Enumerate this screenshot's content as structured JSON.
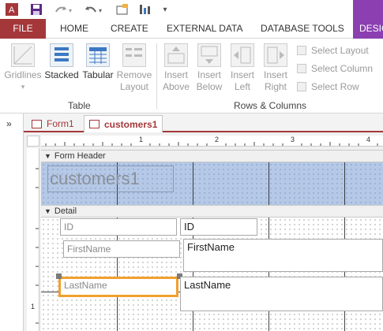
{
  "qat": {
    "icons": [
      "access-logo-icon",
      "save-icon",
      "redo-icon",
      "undo-icon",
      "form-view-icon",
      "design-tool-icon",
      "customize-icon"
    ]
  },
  "tabs": {
    "file": "FILE",
    "home": "HOME",
    "create": "CREATE",
    "external": "EXTERNAL DATA",
    "dbtools": "DATABASE TOOLS",
    "design": "DESIG"
  },
  "ribbon": {
    "table_group": {
      "label": "Table",
      "gridlines": "Gridlines",
      "stacked": "Stacked",
      "tabular": "Tabular",
      "remove_layout_1": "Remove",
      "remove_layout_2": "Layout"
    },
    "rows_columns_group": {
      "label": "Rows & Columns",
      "insert_above_1": "Insert",
      "insert_above_2": "Above",
      "insert_below_1": "Insert",
      "insert_below_2": "Below",
      "insert_left_1": "Insert",
      "insert_left_2": "Left",
      "insert_right_1": "Insert",
      "insert_right_2": "Right",
      "select_layout": "Select Layout",
      "select_column": "Select Column",
      "select_row": "Select Row"
    }
  },
  "nav": {
    "chevron": "»"
  },
  "doc_tabs": [
    {
      "label": "Form1",
      "active": false
    },
    {
      "label": "customers1",
      "active": true
    }
  ],
  "design": {
    "ruler_numbers": [
      "1",
      "2",
      "3",
      "4"
    ],
    "vruler_numbers": [
      "1"
    ],
    "form_header_label": "Form Header",
    "detail_label": "Detail",
    "title": "customers1",
    "fields": [
      {
        "label": "ID",
        "value": "ID"
      },
      {
        "label": "FirstName",
        "value": "FirstName"
      },
      {
        "label": "LastName",
        "value": "LastName"
      }
    ]
  },
  "colors": {
    "file_tab": "#a4373a",
    "design_tab": "#8b3fb0",
    "selection": "#f0a030",
    "header_fill": "#b5c8e6"
  }
}
